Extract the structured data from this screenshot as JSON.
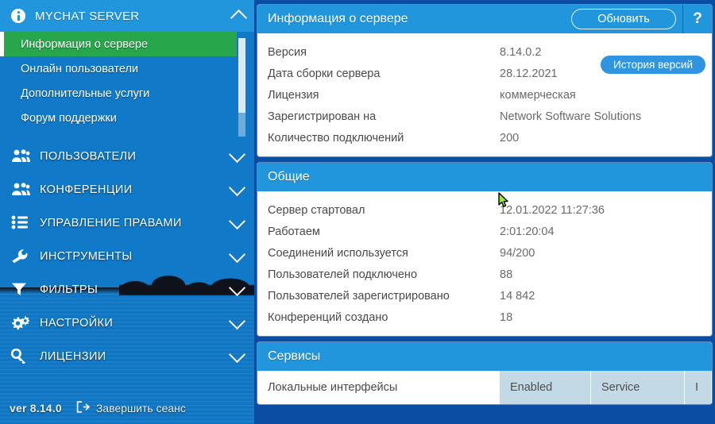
{
  "sidebar": {
    "header": {
      "title": "MYCHAT SERVER",
      "icon": "info-circle-icon",
      "chevron": "chevron-up-icon"
    },
    "sub_items": [
      {
        "label": "Информация о сервере",
        "active": true
      },
      {
        "label": "Онлайн пользователи",
        "active": false
      },
      {
        "label": "Дополнительные услуги",
        "active": false
      },
      {
        "label": "Форум поддержки",
        "active": false
      }
    ],
    "groups": [
      {
        "label": "ПОЛЬЗОВАТЕЛИ",
        "icon": "users-group-icon",
        "chevron": "chevron-down-icon"
      },
      {
        "label": "КОНФЕРЕНЦИИ",
        "icon": "users-group-icon",
        "chevron": "chevron-down-icon"
      },
      {
        "label": "УПРАВЛЕНИЕ ПРАВАМИ",
        "icon": "list-icon",
        "chevron": "chevron-down-icon"
      },
      {
        "label": "ИНСТРУМЕНТЫ",
        "icon": "wrench-icon",
        "chevron": "chevron-down-icon"
      },
      {
        "label": "ФИЛЬТРЫ",
        "icon": "funnel-icon",
        "chevron": "chevron-down-icon"
      },
      {
        "label": "НАСТРОЙКИ",
        "icon": "gears-icon",
        "chevron": "chevron-down-icon"
      },
      {
        "label": "ЛИЦЕНЗИИ",
        "icon": "key-icon",
        "chevron": "chevron-down-icon"
      }
    ],
    "footer": {
      "version": "ver 8.14.0",
      "logout_label": "Завершить сеанс",
      "logout_icon": "logout-icon"
    }
  },
  "main": {
    "server_info": {
      "title": "Информация о сервере",
      "refresh_label": "Обновить",
      "help_label": "?",
      "history_label": "История версий",
      "rows": [
        {
          "key": "Версия",
          "value": "8.14.0.2"
        },
        {
          "key": "Дата сборки сервера",
          "value": "28.12.2021"
        },
        {
          "key": "Лицензия",
          "value": "коммерческая"
        },
        {
          "key": "Зарегистрирован на",
          "value": "Network Software Solutions"
        },
        {
          "key": "Количество подключений",
          "value": "200"
        }
      ]
    },
    "general": {
      "title": "Общие",
      "rows": [
        {
          "key": "Сервер стартовал",
          "value": "12.01.2022 11:27:36"
        },
        {
          "key": "Работаем",
          "value": "2:01:20:04"
        },
        {
          "key": "Соединений используется",
          "value": "94/200"
        },
        {
          "key": "Пользователей подключено",
          "value": "88"
        },
        {
          "key": "Пользователей зарегистрировано",
          "value": "14 842"
        },
        {
          "key": "Конференций создано",
          "value": "18"
        }
      ]
    },
    "services": {
      "title": "Сервисы",
      "row_label": "Локальные интерфейсы",
      "columns": [
        "Enabled",
        "Service",
        "I"
      ]
    }
  },
  "colors": {
    "accent_blue": "#2196dd",
    "dark_blue": "#0a4ea3",
    "active_green": "#27a64b",
    "table_header": "#c3d9e6"
  }
}
